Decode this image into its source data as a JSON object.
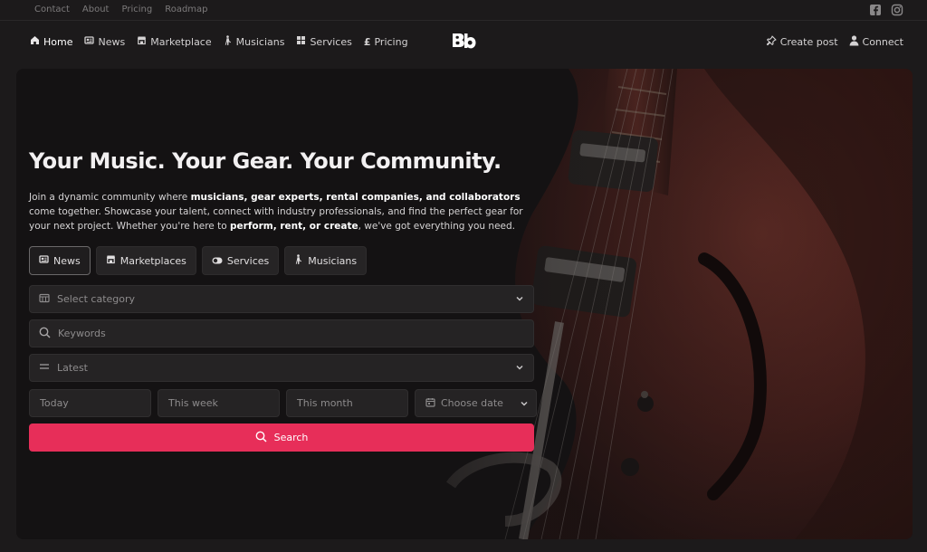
{
  "topbar": {
    "links": [
      "Contact",
      "About",
      "Pricing",
      "Roadmap"
    ],
    "social": [
      "facebook-icon",
      "instagram-icon"
    ]
  },
  "nav": {
    "items": [
      {
        "label": "Home",
        "icon": "home-icon"
      },
      {
        "label": "News",
        "icon": "newspaper-icon"
      },
      {
        "label": "Marketplace",
        "icon": "store-icon"
      },
      {
        "label": "Musicians",
        "icon": "guitarist-icon"
      },
      {
        "label": "Services",
        "icon": "grid-icon"
      },
      {
        "label": "Pricing",
        "icon": "pound-icon"
      }
    ],
    "logo": "Bb",
    "right": {
      "create_post": "Create post",
      "connect": "Connect"
    }
  },
  "hero": {
    "title": "Your Music. Your Gear. Your Community.",
    "intro": {
      "p1": "Join a dynamic community where ",
      "b1": "musicians, gear experts, rental companies, and collaborators",
      "p2": " come together. Showcase your talent, connect with industry professionals, and find the perfect gear for your next project. Whether you're here to ",
      "b2": "perform, rent, or create",
      "p3": ", we've got everything you need."
    },
    "tabs": [
      {
        "label": "News",
        "icon": "newspaper-icon"
      },
      {
        "label": "Marketplaces",
        "icon": "store-icon"
      },
      {
        "label": "Services",
        "icon": "toggle-icon"
      },
      {
        "label": "Musicians",
        "icon": "guitarist-icon"
      }
    ],
    "active_tab": "News",
    "category_placeholder": "Select category",
    "keywords_placeholder": "Keywords",
    "sort_value": "Latest",
    "dates": [
      "Today",
      "This week",
      "This month",
      "Choose date"
    ],
    "search_label": "Search"
  },
  "colors": {
    "accent": "#e72e59",
    "background": "#1c1a1b"
  }
}
